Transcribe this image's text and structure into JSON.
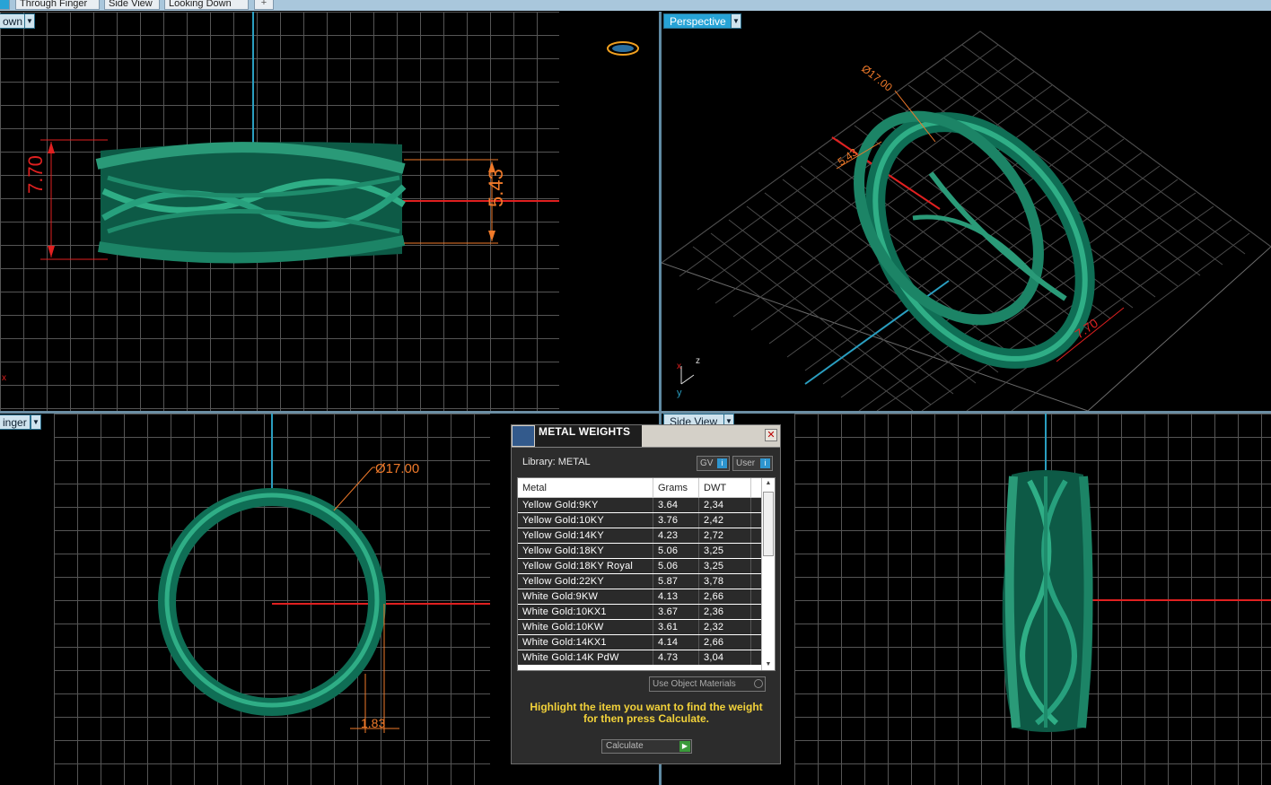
{
  "tabs": [
    "own",
    "Through Finger",
    "Side View",
    "Looking Down"
  ],
  "tab_add": "+",
  "viewports": {
    "top_left": {
      "label": "own",
      "dims": {
        "height": "7.70",
        "width": "5.43"
      }
    },
    "top_right": {
      "label": "Perspective",
      "dims": {
        "diameter": "Ø17.00",
        "width": "5.43",
        "height": "7.70"
      }
    },
    "bottom_left": {
      "label": "inger",
      "dims": {
        "diameter": "Ø17.00",
        "thickness": "1.83"
      }
    },
    "bottom_right": {
      "label": "Side View"
    }
  },
  "axis": {
    "x": "x",
    "z": "z",
    "y": "y"
  },
  "dialog": {
    "title": "METAL WEIGHTS",
    "library": "Library: METAL",
    "gv_label": "GV",
    "user_label": "User",
    "columns": [
      "Metal",
      "Grams",
      "DWT"
    ],
    "rows": [
      [
        "Yellow Gold:9KY",
        "3.64",
        "2,34"
      ],
      [
        "Yellow Gold:10KY",
        "3.76",
        "2,42"
      ],
      [
        "Yellow Gold:14KY",
        "4.23",
        "2,72"
      ],
      [
        "Yellow Gold:18KY",
        "5.06",
        "3,25"
      ],
      [
        "Yellow Gold:18KY Royal",
        "5.06",
        "3,25"
      ],
      [
        "Yellow Gold:22KY",
        "5.87",
        "3,78"
      ],
      [
        "White Gold:9KW",
        "4.13",
        "2,66"
      ],
      [
        "White Gold:10KX1",
        "3.67",
        "2,36"
      ],
      [
        "White Gold:10KW",
        "3.61",
        "2,32"
      ],
      [
        "White Gold:14KX1",
        "4.14",
        "2,66"
      ],
      [
        "White Gold:14K PdW",
        "4.73",
        "3,04"
      ]
    ],
    "use_object_materials": "Use Object Materials",
    "hint_line1": "Highlight the item you want to find the weight",
    "hint_line2": "for then press Calculate.",
    "calculate": "Calculate"
  },
  "colors": {
    "ring": "#0f6e55",
    "ring_highlight": "#2fae86",
    "dim_red": "#e02020",
    "dim_orange": "#f07a2a",
    "axis_blue": "#2a9ec0",
    "label_blue": "#27a3d6"
  }
}
